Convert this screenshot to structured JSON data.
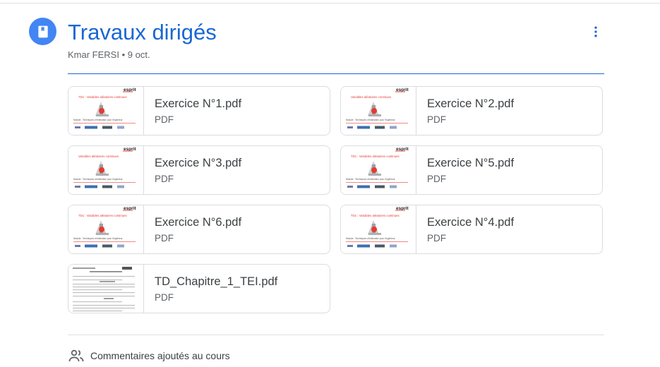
{
  "assignment": {
    "title": "Travaux dirigés",
    "author": "Kmar FERSI",
    "separator": "•",
    "date": "9 oct.",
    "icon": "book-icon",
    "more_icon": "more-vert-icon"
  },
  "attachments": [
    {
      "name": "Exercice N°1.pdf",
      "type": "PDF",
      "thumb_heading": "TD1 : Variables aléatoires continues"
    },
    {
      "name": "Exercice N°2.pdf",
      "type": "PDF",
      "thumb_heading": "Variables aléatoires continues"
    },
    {
      "name": "Exercice N°3.pdf",
      "type": "PDF",
      "thumb_heading": "Variables aléatoires continues"
    },
    {
      "name": "Exercice N°5.pdf",
      "type": "PDF",
      "thumb_heading": "TD1 : Variables aléatoires continues"
    },
    {
      "name": "Exercice N°6.pdf",
      "type": "PDF",
      "thumb_heading": "TD1 : Variables aléatoires continues"
    },
    {
      "name": "Exercice N°4.pdf",
      "type": "PDF",
      "thumb_heading": "TD1 : Variables aléatoires continues"
    },
    {
      "name": "TD_Chapitre_1_TEI.pdf",
      "type": "PDF",
      "thumb_heading": ""
    }
  ],
  "thumb_common": {
    "logo": "esprit",
    "subtitle": "Module : Techniques d'estimation pour l'ingénieur"
  },
  "comments": {
    "label": "Commentaires ajoutés au cours",
    "icon": "people-icon"
  },
  "colors": {
    "accent": "#1967d2",
    "icon_bg": "#4285f4",
    "thumb_red": "#e53935"
  }
}
